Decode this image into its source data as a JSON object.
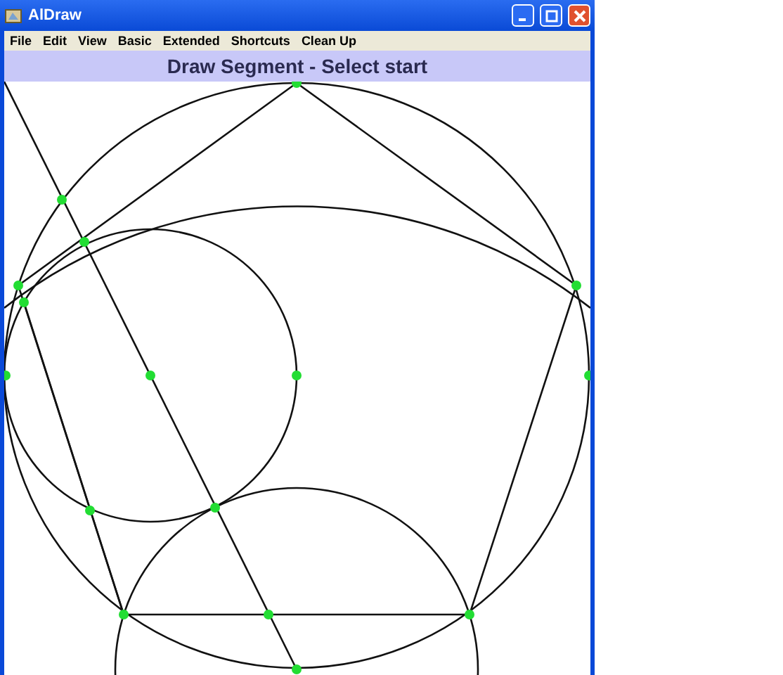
{
  "window": {
    "title": "AlDraw"
  },
  "menu": [
    {
      "label": "File"
    },
    {
      "label": "Edit"
    },
    {
      "label": "View"
    },
    {
      "label": "Basic"
    },
    {
      "label": "Extended"
    },
    {
      "label": "Shortcuts"
    },
    {
      "label": "Clean Up"
    }
  ],
  "status_bar": {
    "text": "Draw Segment - Select start"
  }
}
